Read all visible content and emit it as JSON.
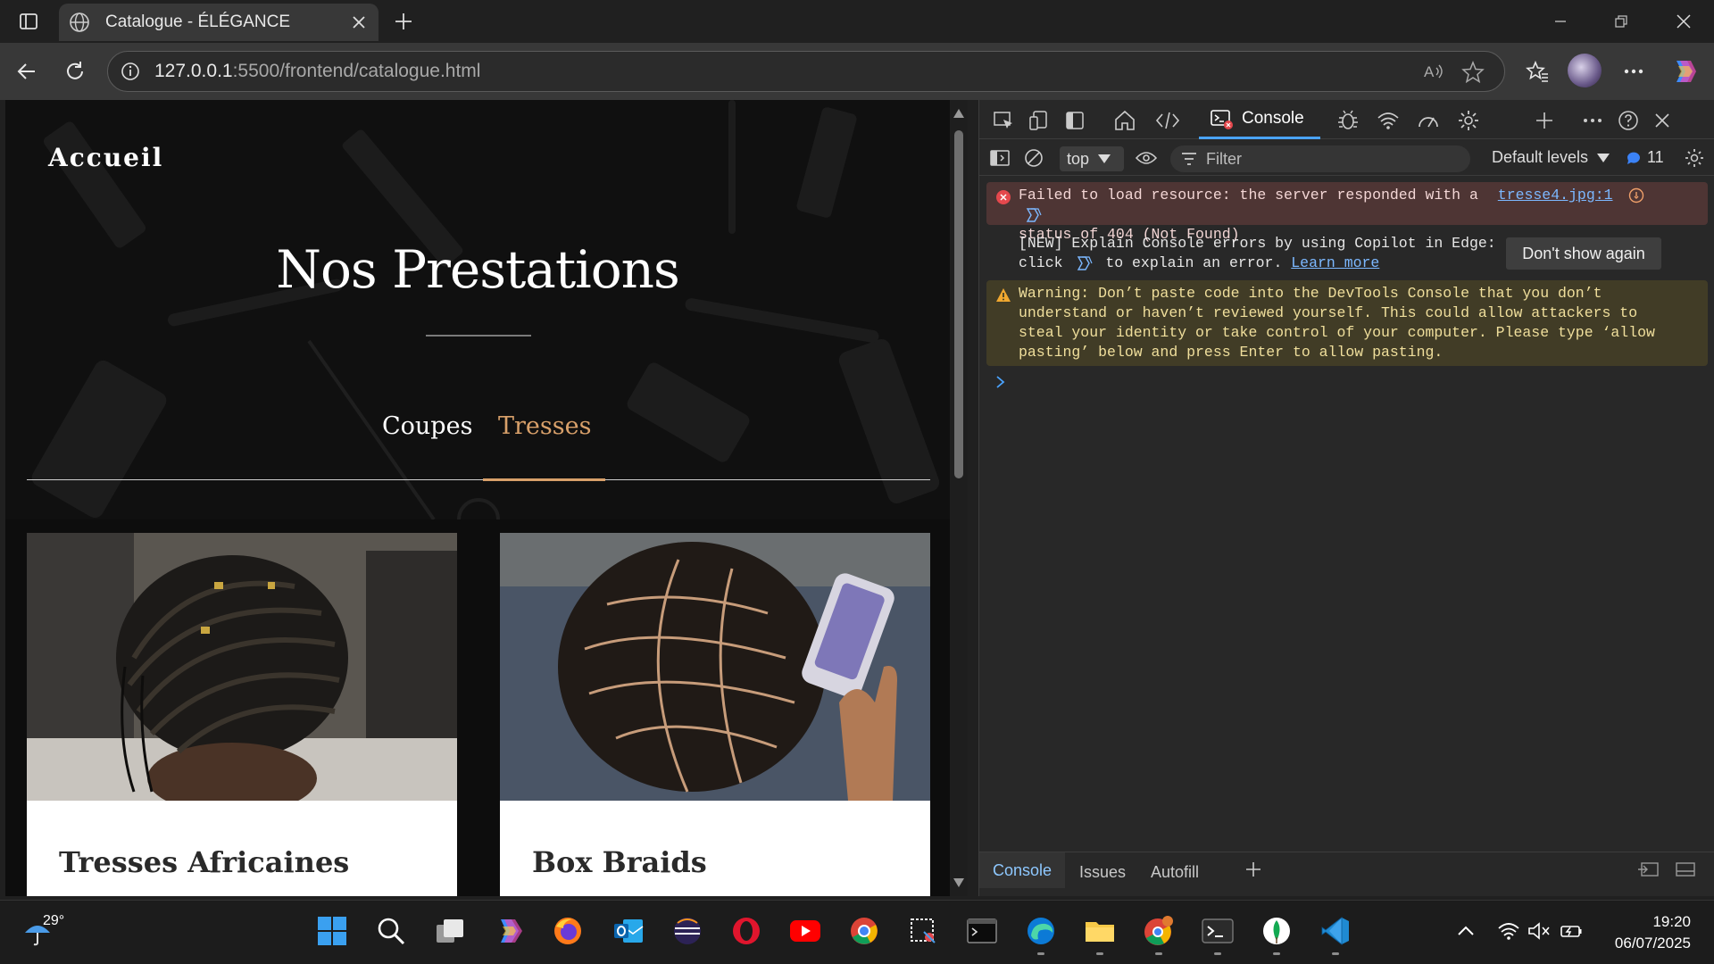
{
  "browser": {
    "tab_title": "Catalogue - ÉLÉGANCE",
    "url_host": "127.0.0.1",
    "url_path": ":5500/frontend/catalogue.html"
  },
  "page": {
    "nav_home": "Accueil",
    "title": "Nos Prestations",
    "categories": [
      {
        "label": "Coupes",
        "active": false
      },
      {
        "label": "Tresses",
        "active": true
      }
    ],
    "cards": [
      {
        "title": "Tresses Africaines"
      },
      {
        "title": "Box Braids"
      }
    ],
    "accent_color": "#d8a06a"
  },
  "devtools": {
    "active_tab": "Console",
    "context": "top",
    "filter_placeholder": "Filter",
    "levels": "Default levels",
    "issues_count": "11",
    "error": {
      "text_1": "Failed to load resource: the server responded with a",
      "text_2": "status of 404 (Not Found)",
      "source": "tresse4.jpg:1"
    },
    "info": {
      "line_1": "[NEW] Explain Console errors by using Copilot in Edge:",
      "line_2a": "click",
      "line_2b": "to explain an error.",
      "link": "Learn more",
      "button": "Don't show again"
    },
    "warning": {
      "line_1": "Warning: Don’t paste code into the DevTools Console that you don’t",
      "line_2": "understand or haven’t reviewed yourself. This could allow attackers to",
      "line_3": "steal your identity or take control of your computer. Please type ‘allow",
      "line_4": "pasting’ below and press Enter to allow pasting."
    },
    "drawer_tabs": [
      "Console",
      "Issues",
      "Autofill"
    ]
  },
  "taskbar": {
    "temperature": "29°",
    "time": "19:20",
    "date": "06/07/2025"
  }
}
